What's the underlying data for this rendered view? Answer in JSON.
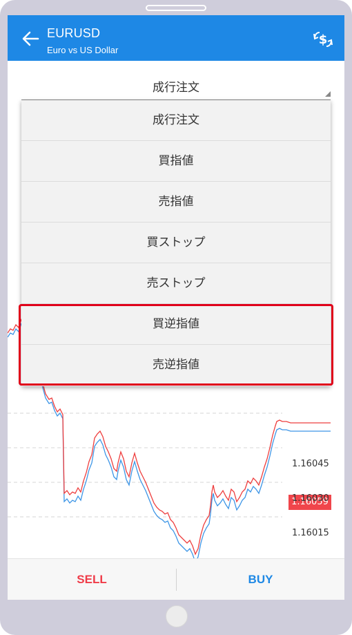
{
  "header": {
    "symbol": "EURUSD",
    "description": "Euro vs US Dollar"
  },
  "order_type": {
    "selected": "成行注文"
  },
  "dropdown": {
    "items": [
      {
        "label": "成行注文"
      },
      {
        "label": "買指値"
      },
      {
        "label": "売指値"
      },
      {
        "label": "買ストップ"
      },
      {
        "label": "売ストップ"
      },
      {
        "label": "買逆指値"
      },
      {
        "label": "売逆指値"
      }
    ]
  },
  "chart": {
    "current_price": "1.16059",
    "price_levels": [
      "1.16045",
      "1.16030",
      "1.16015"
    ]
  },
  "actions": {
    "sell_label": "SELL",
    "buy_label": "BUY"
  },
  "colors": {
    "accent": "#1e88e5",
    "sell": "#ef3b48",
    "highlight_border": "#e0001a"
  }
}
